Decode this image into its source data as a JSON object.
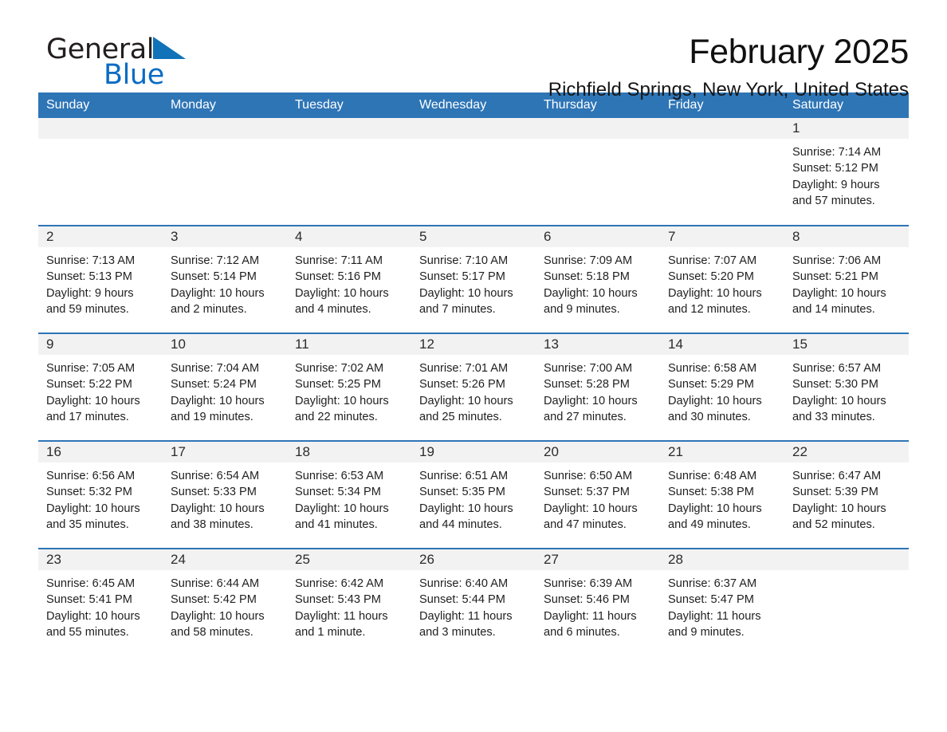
{
  "brand": {
    "name_part1": "General",
    "name_part2": "Blue",
    "logo_icon": "triangle-logo-icon",
    "accent_color": "#0a6cc4"
  },
  "header": {
    "title": "February 2025",
    "subtitle": "Richfield Springs, New York, United States"
  },
  "theme": {
    "header_blue": "#2e75b6",
    "daynum_band": "#f2f2f2",
    "separator_blue": "#2e75b6"
  },
  "weekdays": [
    "Sunday",
    "Monday",
    "Tuesday",
    "Wednesday",
    "Thursday",
    "Friday",
    "Saturday"
  ],
  "weeks": [
    [
      {
        "day": "",
        "blank": true,
        "sunrise": "",
        "sunset": "",
        "daylight_line1": "",
        "daylight_line2": ""
      },
      {
        "day": "",
        "blank": true,
        "sunrise": "",
        "sunset": "",
        "daylight_line1": "",
        "daylight_line2": ""
      },
      {
        "day": "",
        "blank": true,
        "sunrise": "",
        "sunset": "",
        "daylight_line1": "",
        "daylight_line2": ""
      },
      {
        "day": "",
        "blank": true,
        "sunrise": "",
        "sunset": "",
        "daylight_line1": "",
        "daylight_line2": ""
      },
      {
        "day": "",
        "blank": true,
        "sunrise": "",
        "sunset": "",
        "daylight_line1": "",
        "daylight_line2": ""
      },
      {
        "day": "",
        "blank": true,
        "sunrise": "",
        "sunset": "",
        "daylight_line1": "",
        "daylight_line2": ""
      },
      {
        "day": "1",
        "blank": false,
        "sunrise": "Sunrise: 7:14 AM",
        "sunset": "Sunset: 5:12 PM",
        "daylight_line1": "Daylight: 9 hours",
        "daylight_line2": "and 57 minutes."
      }
    ],
    [
      {
        "day": "2",
        "blank": false,
        "sunrise": "Sunrise: 7:13 AM",
        "sunset": "Sunset: 5:13 PM",
        "daylight_line1": "Daylight: 9 hours",
        "daylight_line2": "and 59 minutes."
      },
      {
        "day": "3",
        "blank": false,
        "sunrise": "Sunrise: 7:12 AM",
        "sunset": "Sunset: 5:14 PM",
        "daylight_line1": "Daylight: 10 hours",
        "daylight_line2": "and 2 minutes."
      },
      {
        "day": "4",
        "blank": false,
        "sunrise": "Sunrise: 7:11 AM",
        "sunset": "Sunset: 5:16 PM",
        "daylight_line1": "Daylight: 10 hours",
        "daylight_line2": "and 4 minutes."
      },
      {
        "day": "5",
        "blank": false,
        "sunrise": "Sunrise: 7:10 AM",
        "sunset": "Sunset: 5:17 PM",
        "daylight_line1": "Daylight: 10 hours",
        "daylight_line2": "and 7 minutes."
      },
      {
        "day": "6",
        "blank": false,
        "sunrise": "Sunrise: 7:09 AM",
        "sunset": "Sunset: 5:18 PM",
        "daylight_line1": "Daylight: 10 hours",
        "daylight_line2": "and 9 minutes."
      },
      {
        "day": "7",
        "blank": false,
        "sunrise": "Sunrise: 7:07 AM",
        "sunset": "Sunset: 5:20 PM",
        "daylight_line1": "Daylight: 10 hours",
        "daylight_line2": "and 12 minutes."
      },
      {
        "day": "8",
        "blank": false,
        "sunrise": "Sunrise: 7:06 AM",
        "sunset": "Sunset: 5:21 PM",
        "daylight_line1": "Daylight: 10 hours",
        "daylight_line2": "and 14 minutes."
      }
    ],
    [
      {
        "day": "9",
        "blank": false,
        "sunrise": "Sunrise: 7:05 AM",
        "sunset": "Sunset: 5:22 PM",
        "daylight_line1": "Daylight: 10 hours",
        "daylight_line2": "and 17 minutes."
      },
      {
        "day": "10",
        "blank": false,
        "sunrise": "Sunrise: 7:04 AM",
        "sunset": "Sunset: 5:24 PM",
        "daylight_line1": "Daylight: 10 hours",
        "daylight_line2": "and 19 minutes."
      },
      {
        "day": "11",
        "blank": false,
        "sunrise": "Sunrise: 7:02 AM",
        "sunset": "Sunset: 5:25 PM",
        "daylight_line1": "Daylight: 10 hours",
        "daylight_line2": "and 22 minutes."
      },
      {
        "day": "12",
        "blank": false,
        "sunrise": "Sunrise: 7:01 AM",
        "sunset": "Sunset: 5:26 PM",
        "daylight_line1": "Daylight: 10 hours",
        "daylight_line2": "and 25 minutes."
      },
      {
        "day": "13",
        "blank": false,
        "sunrise": "Sunrise: 7:00 AM",
        "sunset": "Sunset: 5:28 PM",
        "daylight_line1": "Daylight: 10 hours",
        "daylight_line2": "and 27 minutes."
      },
      {
        "day": "14",
        "blank": false,
        "sunrise": "Sunrise: 6:58 AM",
        "sunset": "Sunset: 5:29 PM",
        "daylight_line1": "Daylight: 10 hours",
        "daylight_line2": "and 30 minutes."
      },
      {
        "day": "15",
        "blank": false,
        "sunrise": "Sunrise: 6:57 AM",
        "sunset": "Sunset: 5:30 PM",
        "daylight_line1": "Daylight: 10 hours",
        "daylight_line2": "and 33 minutes."
      }
    ],
    [
      {
        "day": "16",
        "blank": false,
        "sunrise": "Sunrise: 6:56 AM",
        "sunset": "Sunset: 5:32 PM",
        "daylight_line1": "Daylight: 10 hours",
        "daylight_line2": "and 35 minutes."
      },
      {
        "day": "17",
        "blank": false,
        "sunrise": "Sunrise: 6:54 AM",
        "sunset": "Sunset: 5:33 PM",
        "daylight_line1": "Daylight: 10 hours",
        "daylight_line2": "and 38 minutes."
      },
      {
        "day": "18",
        "blank": false,
        "sunrise": "Sunrise: 6:53 AM",
        "sunset": "Sunset: 5:34 PM",
        "daylight_line1": "Daylight: 10 hours",
        "daylight_line2": "and 41 minutes."
      },
      {
        "day": "19",
        "blank": false,
        "sunrise": "Sunrise: 6:51 AM",
        "sunset": "Sunset: 5:35 PM",
        "daylight_line1": "Daylight: 10 hours",
        "daylight_line2": "and 44 minutes."
      },
      {
        "day": "20",
        "blank": false,
        "sunrise": "Sunrise: 6:50 AM",
        "sunset": "Sunset: 5:37 PM",
        "daylight_line1": "Daylight: 10 hours",
        "daylight_line2": "and 47 minutes."
      },
      {
        "day": "21",
        "blank": false,
        "sunrise": "Sunrise: 6:48 AM",
        "sunset": "Sunset: 5:38 PM",
        "daylight_line1": "Daylight: 10 hours",
        "daylight_line2": "and 49 minutes."
      },
      {
        "day": "22",
        "blank": false,
        "sunrise": "Sunrise: 6:47 AM",
        "sunset": "Sunset: 5:39 PM",
        "daylight_line1": "Daylight: 10 hours",
        "daylight_line2": "and 52 minutes."
      }
    ],
    [
      {
        "day": "23",
        "blank": false,
        "sunrise": "Sunrise: 6:45 AM",
        "sunset": "Sunset: 5:41 PM",
        "daylight_line1": "Daylight: 10 hours",
        "daylight_line2": "and 55 minutes."
      },
      {
        "day": "24",
        "blank": false,
        "sunrise": "Sunrise: 6:44 AM",
        "sunset": "Sunset: 5:42 PM",
        "daylight_line1": "Daylight: 10 hours",
        "daylight_line2": "and 58 minutes."
      },
      {
        "day": "25",
        "blank": false,
        "sunrise": "Sunrise: 6:42 AM",
        "sunset": "Sunset: 5:43 PM",
        "daylight_line1": "Daylight: 11 hours",
        "daylight_line2": "and 1 minute."
      },
      {
        "day": "26",
        "blank": false,
        "sunrise": "Sunrise: 6:40 AM",
        "sunset": "Sunset: 5:44 PM",
        "daylight_line1": "Daylight: 11 hours",
        "daylight_line2": "and 3 minutes."
      },
      {
        "day": "27",
        "blank": false,
        "sunrise": "Sunrise: 6:39 AM",
        "sunset": "Sunset: 5:46 PM",
        "daylight_line1": "Daylight: 11 hours",
        "daylight_line2": "and 6 minutes."
      },
      {
        "day": "28",
        "blank": false,
        "sunrise": "Sunrise: 6:37 AM",
        "sunset": "Sunset: 5:47 PM",
        "daylight_line1": "Daylight: 11 hours",
        "daylight_line2": "and 9 minutes."
      },
      {
        "day": "",
        "blank": true,
        "sunrise": "",
        "sunset": "",
        "daylight_line1": "",
        "daylight_line2": ""
      }
    ]
  ]
}
